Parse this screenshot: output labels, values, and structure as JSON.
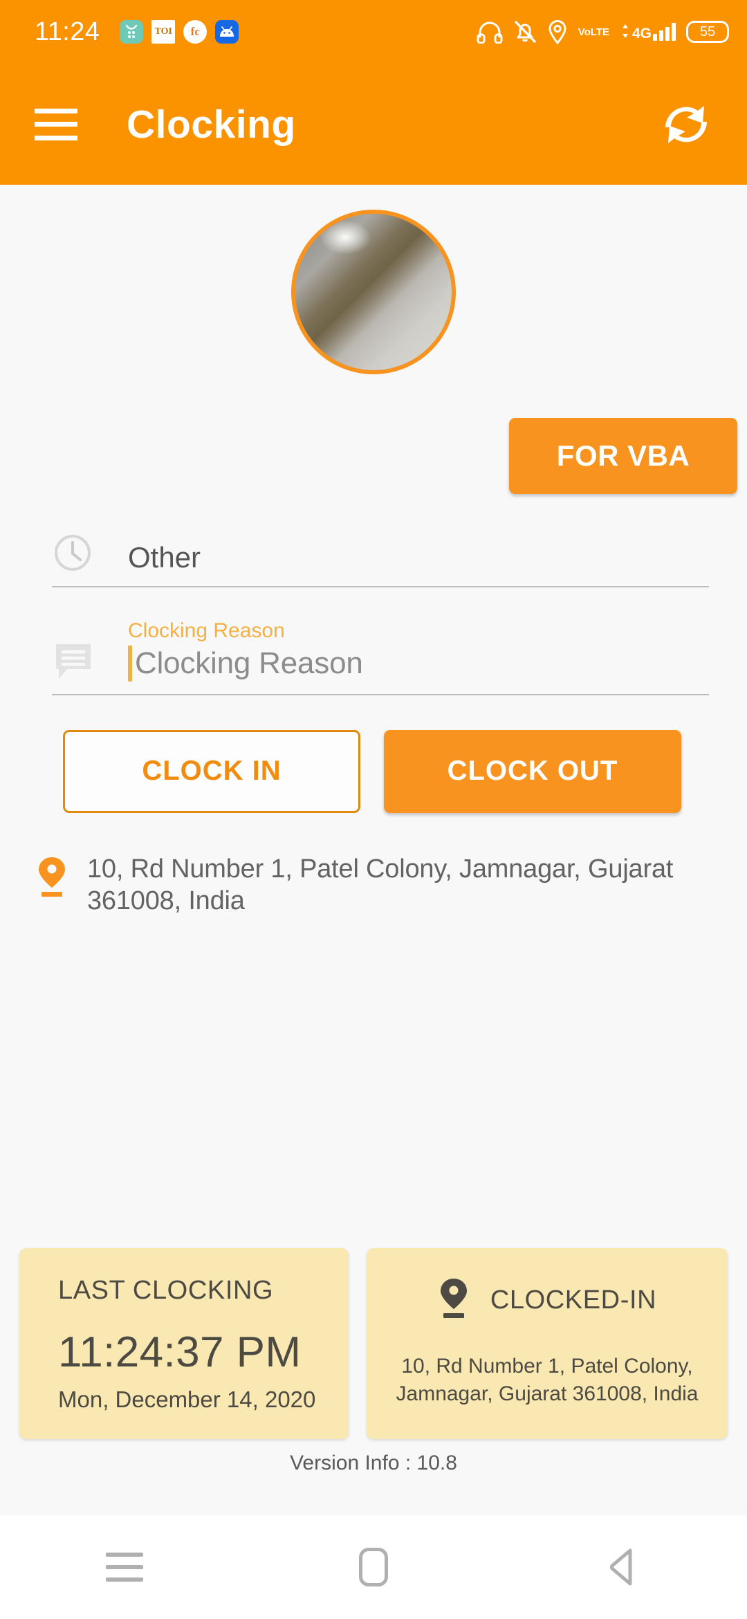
{
  "status_bar": {
    "clock": "11:24",
    "notification_icons": [
      "calendar-teal-icon",
      "toi-news-icon",
      "fc-icon",
      "android-icon"
    ],
    "toi_label": "TOI",
    "fc_label": "fc",
    "volte_line1": "Vo",
    "volte_line2": "LTE",
    "network_label": "4G",
    "battery_percent": "55",
    "system_icons": [
      "headphones-icon",
      "bell-muted-icon",
      "location-icon",
      "volte-icon",
      "signal-bars-icon",
      "battery-icon"
    ]
  },
  "app_bar": {
    "menu_icon": "hamburger-menu-icon",
    "title": "Clocking",
    "refresh_icon": "refresh-sync-icon"
  },
  "main": {
    "avatar_alt": "user-photo",
    "for_vba_label": "FOR VBA",
    "clocking_type": {
      "icon": "clock-icon",
      "value": "Other"
    },
    "clocking_reason": {
      "icon": "message-bubble-icon",
      "label": "Clocking Reason",
      "placeholder": "Clocking Reason",
      "value": ""
    },
    "clock_in_label": "CLOCK IN",
    "clock_out_label": "CLOCK OUT",
    "current_location": {
      "icon": "location-pin-icon",
      "address": "10, Rd Number 1, Patel Colony, Jamnagar, Gujarat 361008, India"
    }
  },
  "cards": {
    "last_clocking": {
      "title": "LAST CLOCKING",
      "time": "11:24:37 PM",
      "date": "Mon, December 14, 2020"
    },
    "clocked_status": {
      "icon": "location-pin-icon",
      "title": "CLOCKED-IN",
      "address": "10, Rd Number 1, Patel Colony, Jamnagar, Gujarat 361008, India"
    }
  },
  "footer": {
    "version": "Version Info : 10.8"
  },
  "nav_bar": {
    "recents": "recents-icon",
    "home": "home-icon",
    "back": "back-icon"
  },
  "colors": {
    "primary_orange": "#FB9200",
    "accent_orange": "#F7931E",
    "card_yellow": "#FAE8B2",
    "page_background": "#F8F8F8",
    "label_orange": "#F5B043"
  }
}
